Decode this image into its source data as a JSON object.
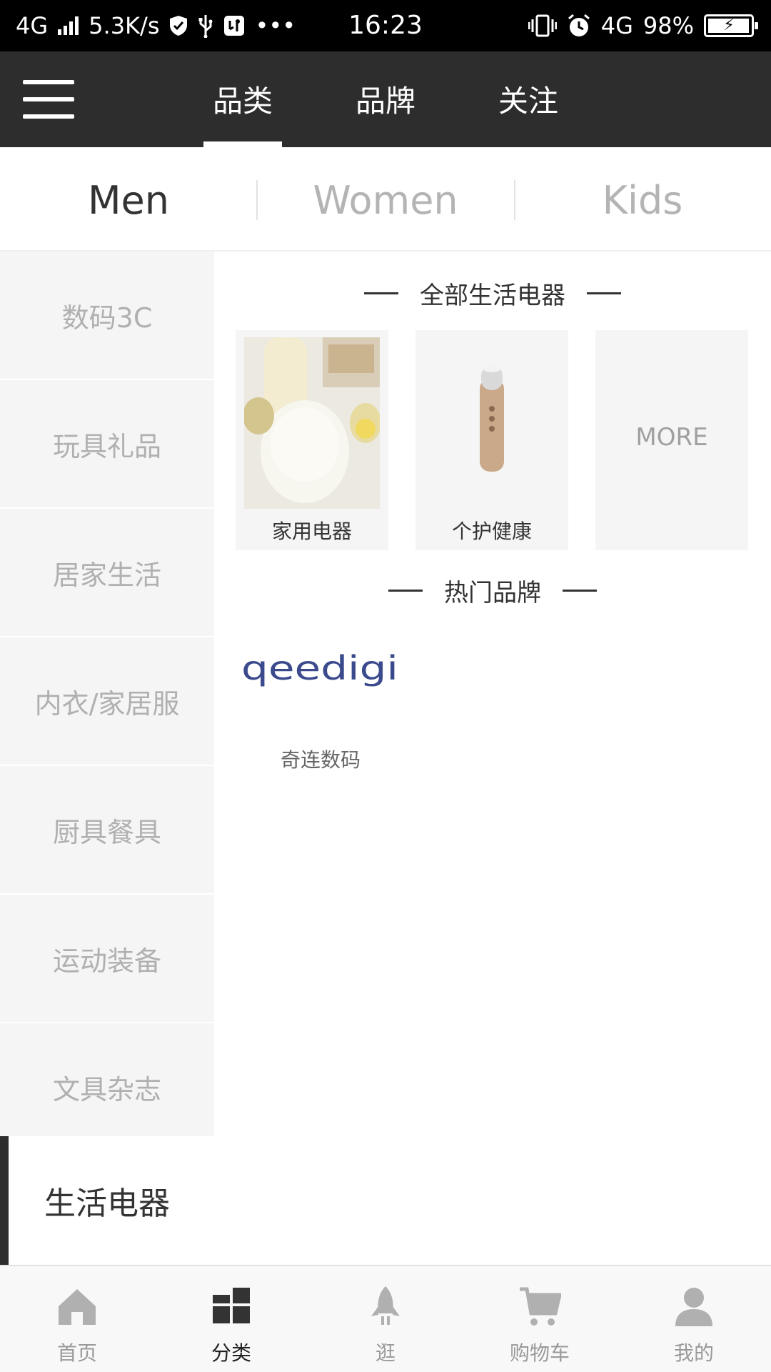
{
  "status_bar": {
    "network": "4G",
    "speed": "5.3K/s",
    "more": "•••",
    "time": "16:23",
    "network_right": "4G",
    "battery_percent": "98%",
    "battery_level": 0.98
  },
  "top_nav": {
    "menu_icon": "hamburger-menu-icon",
    "tabs": [
      {
        "label": "品类",
        "active": true
      },
      {
        "label": "品牌",
        "active": false
      },
      {
        "label": "关注",
        "active": false
      }
    ]
  },
  "gender_tabs": [
    {
      "label": "Men",
      "active": true
    },
    {
      "label": "Women",
      "active": false
    },
    {
      "label": "Kids",
      "active": false
    }
  ],
  "sidebar": {
    "items": [
      {
        "label": "数码3C"
      },
      {
        "label": "玩具礼品"
      },
      {
        "label": "居家生活"
      },
      {
        "label": "内衣/家居服"
      },
      {
        "label": "厨具餐具"
      },
      {
        "label": "运动装备"
      },
      {
        "label": "文具杂志"
      },
      {
        "label": "生活电器",
        "active": true
      }
    ]
  },
  "content": {
    "all_title": "全部生活电器",
    "categories": [
      {
        "label": "家用电器",
        "image": "appliance-photo"
      },
      {
        "label": "个护健康",
        "image": "beauty-device-photo"
      }
    ],
    "more_label": "MORE",
    "brands_title": "热门品牌",
    "brands": [
      {
        "logo": "qeedigi",
        "name": "奇连数码"
      }
    ]
  },
  "bottom_nav": [
    {
      "label": "首页",
      "icon": "home-icon",
      "active": false
    },
    {
      "label": "分类",
      "icon": "category-icon",
      "active": true
    },
    {
      "label": "逛",
      "icon": "rocket-icon",
      "active": false
    },
    {
      "label": "购物车",
      "icon": "cart-icon",
      "active": false
    },
    {
      "label": "我的",
      "icon": "user-icon",
      "active": false
    }
  ],
  "colors": {
    "header_bg": "#2d2d2d",
    "sidebar_bg": "#f4f5f4",
    "brand_logo": "#3a4a8c"
  }
}
